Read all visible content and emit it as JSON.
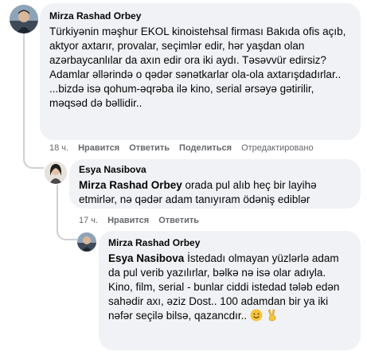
{
  "comments": [
    {
      "author": "Mirza Rashad Orbey",
      "text": "Türkiyənin məşhur EKOL kinoistehsal firması Bakıda ofis açıb, aktyor axtarır, provalar, seçimlər edir, hər yaşdan olan azərbaycanlılar da axın edir ora iki aydı. Təsəvvür edirsiz? Adamlar əllərində o qədər sənətkarlar ola-ola axtarışdadırlar..\n...bizdə isə qohum-əqrəba ilə kino, serial ərsəyə gətirilir, məqsəd də bəllidir..",
      "time": "18 ч.",
      "like_label": "Нравится",
      "reply_label": "Ответить",
      "share_label": "Поделиться",
      "edited_label": "Отредактировано"
    },
    {
      "author": "Esya Nasibova",
      "mention": "Mirza Rashad Orbey",
      "text": " orada pul alıb heç bir layihə etmirlər, nə qədər adam tanıyıram ödəniş ediblər",
      "time": "17 ч.",
      "like_label": "Нравится",
      "reply_label": "Ответить"
    },
    {
      "author": "Mirza Rashad Orbey",
      "mention": "Esya Nasibova",
      "text": " İstedadı olmayan yüzlərlə adam da pul verib yazılırlar, bəlkə nə isə olar adıyla. Kino, film, serial - bunlar ciddi istedad tələb edən sahədir axı, əziz Dost.. 100 adamdan bir ya iki nəfər seçilə bilsə, qazancdır.. ",
      "emojis": [
        "smiling-face-icon",
        "victory-hand-icon"
      ]
    }
  ]
}
